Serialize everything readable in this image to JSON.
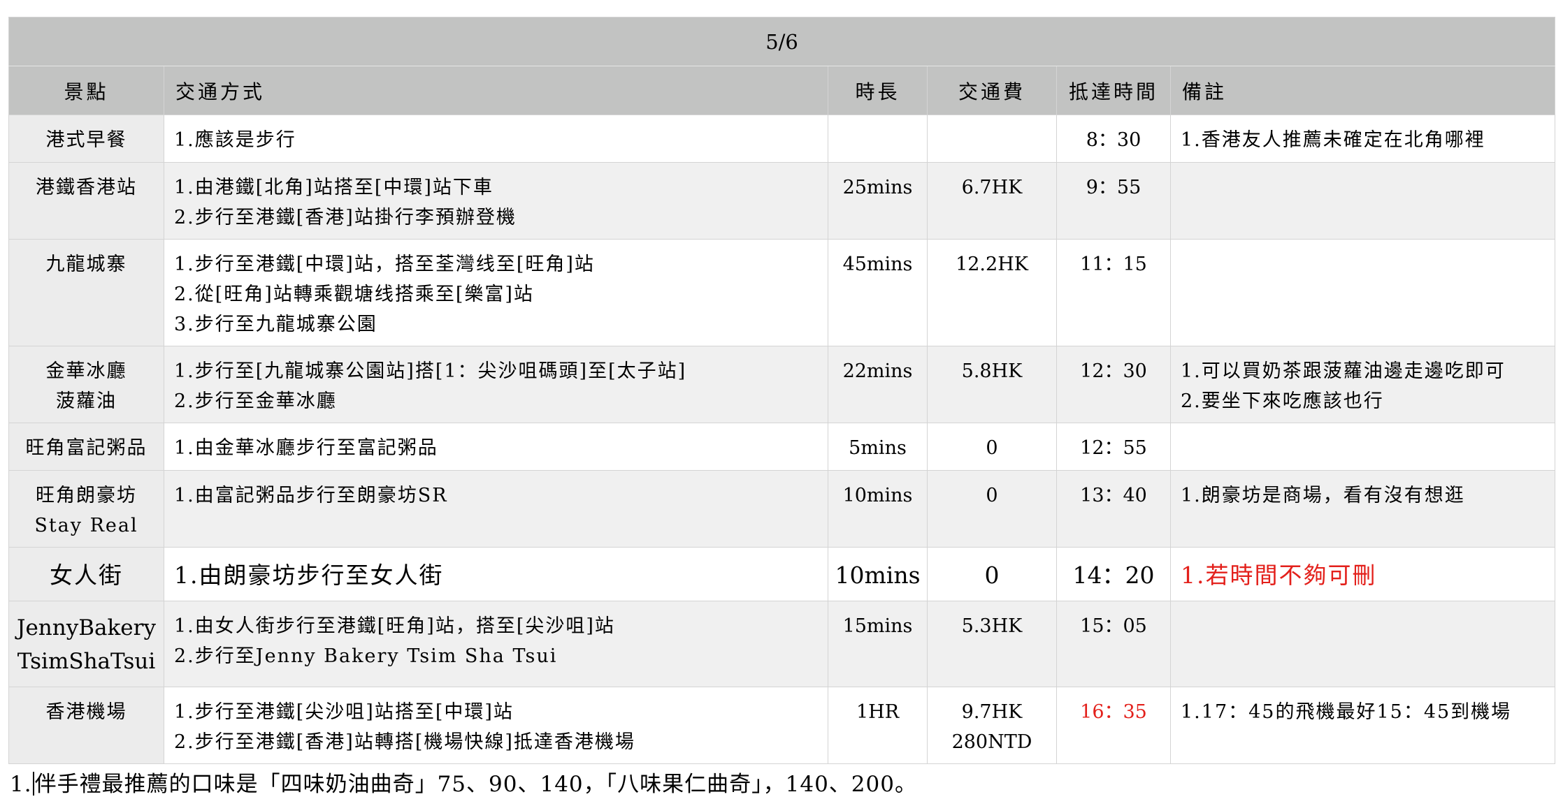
{
  "date": "5/6",
  "headers": {
    "spot": "景點",
    "transport": "交通方式",
    "duration": "時長",
    "fare": "交通費",
    "arrival": "抵達時間",
    "notes": "備註"
  },
  "rows": [
    {
      "spot": [
        "港式早餐"
      ],
      "transport": [
        "1.應該是步行"
      ],
      "duration": "",
      "fare": [
        ""
      ],
      "arrival": "8：30",
      "notes": [
        "1.香港友人推薦未確定在北角哪裡"
      ]
    },
    {
      "spot": [
        "港鐵香港站"
      ],
      "transport": [
        "1.由港鐵[北角]站搭至[中環]站下車",
        "2.步行至港鐵[香港]站掛行李預辦登機"
      ],
      "duration": "25mins",
      "fare": [
        "6.7HK"
      ],
      "arrival": "9：55",
      "notes": []
    },
    {
      "spot": [
        "九龍城寨"
      ],
      "transport": [
        "1.步行至港鐵[中環]站，搭至荃灣线至[旺角]站",
        "2.從[旺角]站轉乘觀塘线搭乘至[樂富]站",
        "3.步行至九龍城寨公園"
      ],
      "duration": "45mins",
      "fare": [
        "12.2HK"
      ],
      "arrival": "11：15",
      "notes": []
    },
    {
      "spot": [
        "金華冰廳",
        "菠蘿油"
      ],
      "transport": [
        "1.步行至[九龍城寨公園站]搭[1：尖沙咀碼頭]至[太子站]",
        "2.步行至金華冰廳"
      ],
      "duration": "22mins",
      "fare": [
        "5.8HK"
      ],
      "arrival": "12：30",
      "notes": [
        "1.可以買奶茶跟菠蘿油邊走邊吃即可",
        "2.要坐下來吃應該也行"
      ]
    },
    {
      "spot": [
        "旺角富記粥品"
      ],
      "transport": [
        "1.由金華冰廳步行至富記粥品"
      ],
      "duration": "5mins",
      "fare": [
        "0"
      ],
      "arrival": "12：55",
      "notes": []
    },
    {
      "spot": [
        "旺角朗豪坊",
        "Stay Real"
      ],
      "transport": [
        "1.由富記粥品步行至朗豪坊SR"
      ],
      "duration": "10mins",
      "fare": [
        "0"
      ],
      "arrival": "13：40",
      "notes": [
        "1.朗豪坊是商場，看有沒有想逛"
      ]
    },
    {
      "spot": [
        "女人街"
      ],
      "transport": [
        "1.由朗豪坊步行至女人街"
      ],
      "duration": "10mins",
      "fare": [
        "0"
      ],
      "arrival": "14：20",
      "notes": [
        "1.若時間不夠可刪"
      ]
    },
    {
      "spot": [
        "JennyBakery",
        "TsimShaTsui"
      ],
      "transport": [
        "1.由女人街步行至港鐵[旺角]站，搭至[尖沙咀]站",
        "2.步行至Jenny Bakery Tsim Sha Tsui"
      ],
      "duration": "15mins",
      "fare": [
        "5.3HK"
      ],
      "arrival": "15：05",
      "notes": []
    },
    {
      "spot": [
        "香港機場"
      ],
      "transport": [
        "1.步行至港鐵[尖沙咀]站搭至[中環]站",
        "2.步行至港鐵[香港]站轉搭[機場快線]抵達香港機場"
      ],
      "duration": "1HR",
      "fare": [
        "9.7HK",
        "280NTD"
      ],
      "arrival": "16：35",
      "notes": [
        "1.17：45的飛機最好15：45到機場"
      ]
    }
  ],
  "footer": {
    "prefix": "1.",
    "text": "伴手禮最推薦的口味是「四味奶油曲奇」75、90、140，「八味果仁曲奇」，140、200。"
  },
  "colors": {
    "header_bg": "#c2c3c2",
    "spot_bg": "#ececec",
    "shade_bg": "#f0f0f0",
    "highlight_red": "#e3201b"
  }
}
